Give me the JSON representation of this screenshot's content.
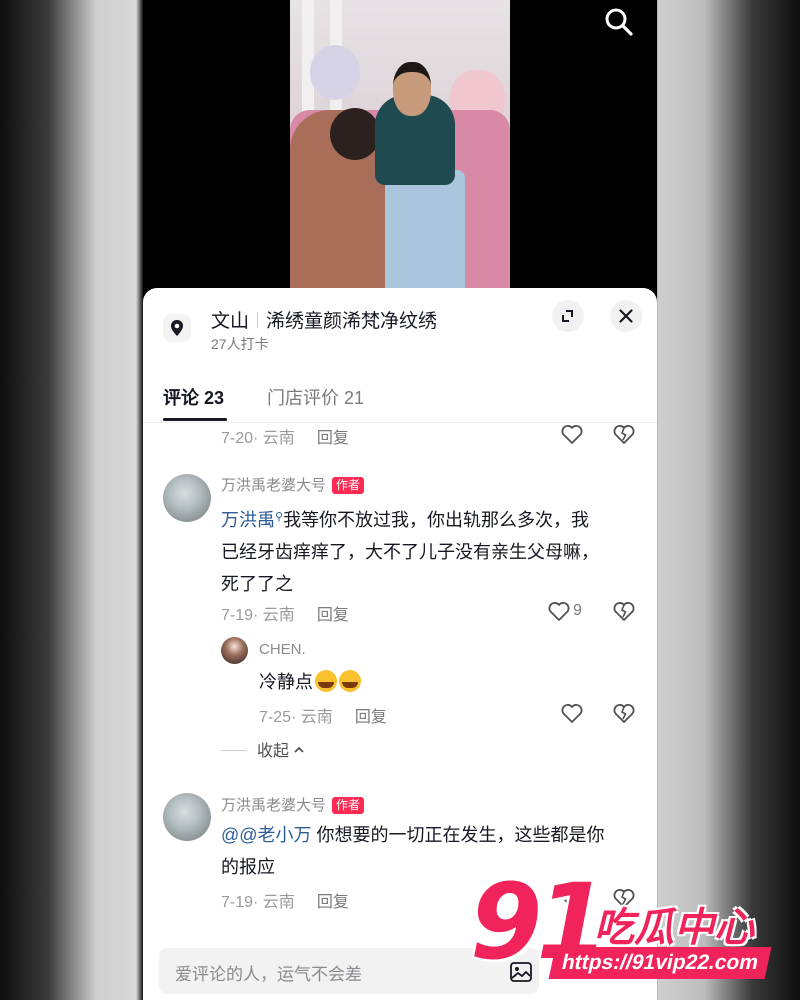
{
  "location": {
    "city": "文山",
    "shop_name": "浠绣童颜浠梵净纹绣",
    "checkins": "27人打卡"
  },
  "tabs": [
    {
      "label": "评论 23"
    },
    {
      "label": "门店评价 21"
    }
  ],
  "previous_meta": {
    "date": "7-20· 云南",
    "reply": "回复"
  },
  "comments": [
    {
      "username": "万洪禹老婆大号",
      "badge": "作者",
      "mention": "万洪禹",
      "text_line1": "我等你不放过我，你出轨那么多次，我",
      "text_line2": "已经牙齿痒痒了，大不了儿子没有亲生父母嘛，",
      "text_line3": "死了了之",
      "date": "7-19· 云南",
      "reply": "回复",
      "likes": "9"
    },
    {
      "username": "万洪禹老婆大号",
      "badge": "作者",
      "mention": "@@老小万",
      "text_line1": " 你想要的一切正在发生，这些都是你",
      "text_line2": "的报应",
      "date": "7-19· 云南",
      "reply": "回复"
    }
  ],
  "reply": {
    "username": "CHEN.",
    "text": "冷静点",
    "date": "7-25· 云南",
    "reply": "回复"
  },
  "collapse_label": "收起",
  "input": {
    "placeholder": "爱评论的人，运气不会差"
  },
  "watermark": {
    "number": "91",
    "name": "吃瓜中心",
    "url": "https://91vip22.com"
  },
  "icons": [
    "search-icon",
    "location-pin-icon",
    "expand-icon",
    "close-icon",
    "heart-icon",
    "broken-heart-icon",
    "image-icon",
    "chevron-up-icon"
  ],
  "colors": {
    "author_badge": "#fe2c55",
    "mention": "#2d5d99",
    "watermark": "#f0245a"
  }
}
